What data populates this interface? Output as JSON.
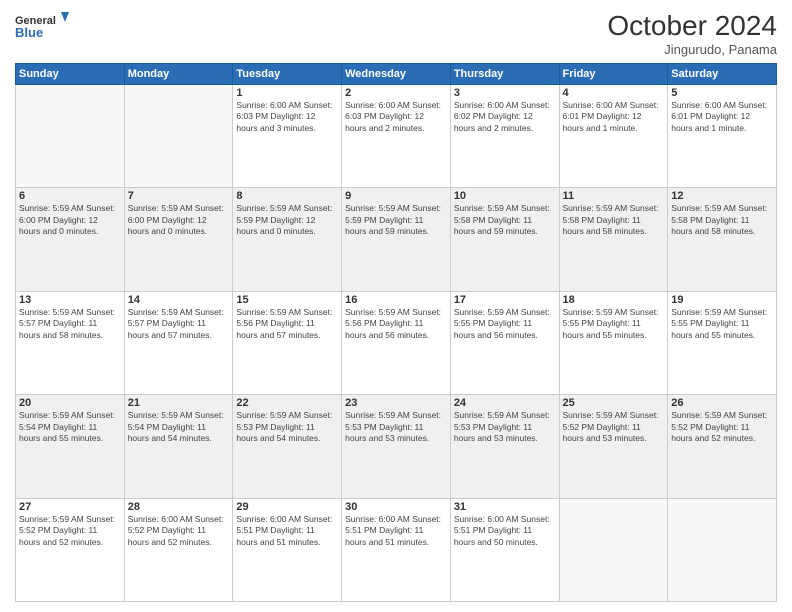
{
  "header": {
    "logo_line1": "General",
    "logo_line2": "Blue",
    "month": "October 2024",
    "location": "Jingurudo, Panama"
  },
  "weekdays": [
    "Sunday",
    "Monday",
    "Tuesday",
    "Wednesday",
    "Thursday",
    "Friday",
    "Saturday"
  ],
  "weeks": [
    [
      {
        "day": "",
        "info": ""
      },
      {
        "day": "",
        "info": ""
      },
      {
        "day": "1",
        "info": "Sunrise: 6:00 AM\nSunset: 6:03 PM\nDaylight: 12 hours\nand 3 minutes."
      },
      {
        "day": "2",
        "info": "Sunrise: 6:00 AM\nSunset: 6:03 PM\nDaylight: 12 hours\nand 2 minutes."
      },
      {
        "day": "3",
        "info": "Sunrise: 6:00 AM\nSunset: 6:02 PM\nDaylight: 12 hours\nand 2 minutes."
      },
      {
        "day": "4",
        "info": "Sunrise: 6:00 AM\nSunset: 6:01 PM\nDaylight: 12 hours\nand 1 minute."
      },
      {
        "day": "5",
        "info": "Sunrise: 6:00 AM\nSunset: 6:01 PM\nDaylight: 12 hours\nand 1 minute."
      }
    ],
    [
      {
        "day": "6",
        "info": "Sunrise: 5:59 AM\nSunset: 6:00 PM\nDaylight: 12 hours\nand 0 minutes."
      },
      {
        "day": "7",
        "info": "Sunrise: 5:59 AM\nSunset: 6:00 PM\nDaylight: 12 hours\nand 0 minutes."
      },
      {
        "day": "8",
        "info": "Sunrise: 5:59 AM\nSunset: 5:59 PM\nDaylight: 12 hours\nand 0 minutes."
      },
      {
        "day": "9",
        "info": "Sunrise: 5:59 AM\nSunset: 5:59 PM\nDaylight: 11 hours\nand 59 minutes."
      },
      {
        "day": "10",
        "info": "Sunrise: 5:59 AM\nSunset: 5:58 PM\nDaylight: 11 hours\nand 59 minutes."
      },
      {
        "day": "11",
        "info": "Sunrise: 5:59 AM\nSunset: 5:58 PM\nDaylight: 11 hours\nand 58 minutes."
      },
      {
        "day": "12",
        "info": "Sunrise: 5:59 AM\nSunset: 5:58 PM\nDaylight: 11 hours\nand 58 minutes."
      }
    ],
    [
      {
        "day": "13",
        "info": "Sunrise: 5:59 AM\nSunset: 5:57 PM\nDaylight: 11 hours\nand 58 minutes."
      },
      {
        "day": "14",
        "info": "Sunrise: 5:59 AM\nSunset: 5:57 PM\nDaylight: 11 hours\nand 57 minutes."
      },
      {
        "day": "15",
        "info": "Sunrise: 5:59 AM\nSunset: 5:56 PM\nDaylight: 11 hours\nand 57 minutes."
      },
      {
        "day": "16",
        "info": "Sunrise: 5:59 AM\nSunset: 5:56 PM\nDaylight: 11 hours\nand 56 minutes."
      },
      {
        "day": "17",
        "info": "Sunrise: 5:59 AM\nSunset: 5:55 PM\nDaylight: 11 hours\nand 56 minutes."
      },
      {
        "day": "18",
        "info": "Sunrise: 5:59 AM\nSunset: 5:55 PM\nDaylight: 11 hours\nand 55 minutes."
      },
      {
        "day": "19",
        "info": "Sunrise: 5:59 AM\nSunset: 5:55 PM\nDaylight: 11 hours\nand 55 minutes."
      }
    ],
    [
      {
        "day": "20",
        "info": "Sunrise: 5:59 AM\nSunset: 5:54 PM\nDaylight: 11 hours\nand 55 minutes."
      },
      {
        "day": "21",
        "info": "Sunrise: 5:59 AM\nSunset: 5:54 PM\nDaylight: 11 hours\nand 54 minutes."
      },
      {
        "day": "22",
        "info": "Sunrise: 5:59 AM\nSunset: 5:53 PM\nDaylight: 11 hours\nand 54 minutes."
      },
      {
        "day": "23",
        "info": "Sunrise: 5:59 AM\nSunset: 5:53 PM\nDaylight: 11 hours\nand 53 minutes."
      },
      {
        "day": "24",
        "info": "Sunrise: 5:59 AM\nSunset: 5:53 PM\nDaylight: 11 hours\nand 53 minutes."
      },
      {
        "day": "25",
        "info": "Sunrise: 5:59 AM\nSunset: 5:52 PM\nDaylight: 11 hours\nand 53 minutes."
      },
      {
        "day": "26",
        "info": "Sunrise: 5:59 AM\nSunset: 5:52 PM\nDaylight: 11 hours\nand 52 minutes."
      }
    ],
    [
      {
        "day": "27",
        "info": "Sunrise: 5:59 AM\nSunset: 5:52 PM\nDaylight: 11 hours\nand 52 minutes."
      },
      {
        "day": "28",
        "info": "Sunrise: 6:00 AM\nSunset: 5:52 PM\nDaylight: 11 hours\nand 52 minutes."
      },
      {
        "day": "29",
        "info": "Sunrise: 6:00 AM\nSunset: 5:51 PM\nDaylight: 11 hours\nand 51 minutes."
      },
      {
        "day": "30",
        "info": "Sunrise: 6:00 AM\nSunset: 5:51 PM\nDaylight: 11 hours\nand 51 minutes."
      },
      {
        "day": "31",
        "info": "Sunrise: 6:00 AM\nSunset: 5:51 PM\nDaylight: 11 hours\nand 50 minutes."
      },
      {
        "day": "",
        "info": ""
      },
      {
        "day": "",
        "info": ""
      }
    ]
  ]
}
